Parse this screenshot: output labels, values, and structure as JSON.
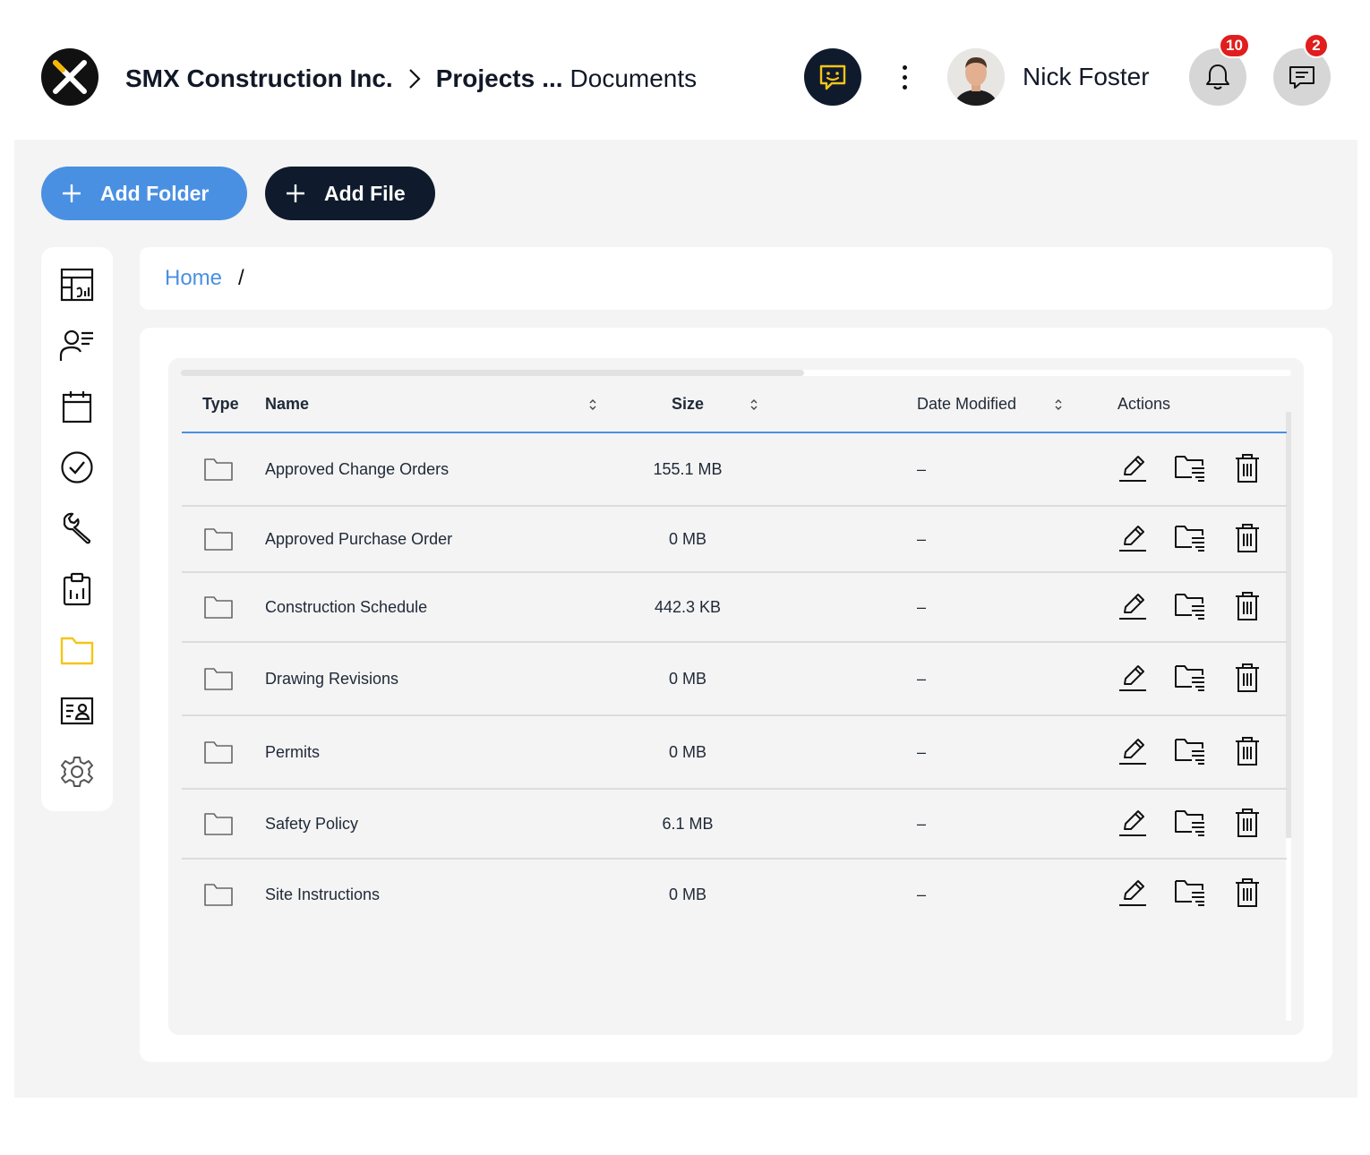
{
  "header": {
    "breadcrumb": {
      "company": "SMX Construction Inc.",
      "section": "Projects",
      "ellipsis": "...",
      "current": "Documents"
    },
    "user_name": "Nick Foster",
    "notifications_count": "10",
    "messages_count": "2"
  },
  "toolbar": {
    "add_folder_label": "Add Folder",
    "add_file_label": "Add File"
  },
  "sidebar": {
    "items": [
      {
        "icon": "dashboard-icon",
        "active": false
      },
      {
        "icon": "contacts-icon",
        "active": false
      },
      {
        "icon": "calendar-icon",
        "active": false
      },
      {
        "icon": "check-circle-icon",
        "active": false
      },
      {
        "icon": "wrench-icon",
        "active": false
      },
      {
        "icon": "clipboard-report-icon",
        "active": false
      },
      {
        "icon": "folder-icon",
        "active": true
      },
      {
        "icon": "id-card-icon",
        "active": false
      },
      {
        "icon": "gear-icon",
        "active": false
      }
    ]
  },
  "path": {
    "home": "Home",
    "separator": "/"
  },
  "table": {
    "columns": {
      "type": "Type",
      "name": "Name",
      "size": "Size",
      "date_modified": "Date Modified",
      "actions": "Actions"
    },
    "rows": [
      {
        "type": "folder",
        "name": "Approved Change Orders",
        "size": "155.1 MB",
        "date": "–"
      },
      {
        "type": "folder",
        "name": "Approved Purchase Order",
        "size": "0 MB",
        "date": "–"
      },
      {
        "type": "folder",
        "name": "Construction Schedule",
        "size": "442.3 KB",
        "date": "–"
      },
      {
        "type": "folder",
        "name": "Drawing Revisions",
        "size": "0 MB",
        "date": "–"
      },
      {
        "type": "folder",
        "name": "Permits",
        "size": "0 MB",
        "date": "–"
      },
      {
        "type": "folder",
        "name": "Safety Policy",
        "size": "6.1 MB",
        "date": "–"
      },
      {
        "type": "folder",
        "name": "Site Instructions",
        "size": "0 MB",
        "date": "–"
      }
    ],
    "row_actions": [
      "edit-icon",
      "move-to-folder-icon",
      "trash-icon"
    ]
  },
  "colors": {
    "accent_blue": "#4a90e2",
    "navy": "#0f1b2d",
    "active_icon": "#f5c518",
    "badge_red": "#e11d1d"
  }
}
